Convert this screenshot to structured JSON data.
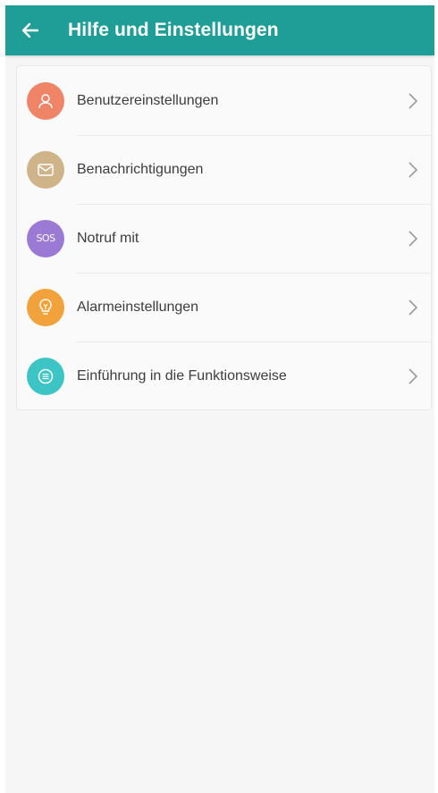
{
  "app_bar": {
    "title": "Hilfe und Einstellungen",
    "color": "#1f9e98"
  },
  "menu": {
    "items": [
      {
        "label": "Benutzereinstellungen",
        "icon": "user-icon",
        "color": "#ef8467"
      },
      {
        "label": "Benachrichtigungen",
        "icon": "mail-icon",
        "color": "#cfb48a"
      },
      {
        "label": "Notruf mit",
        "icon": "sos-icon",
        "icon_text": "SOS",
        "color": "#9b7ad6"
      },
      {
        "label": "Alarmeinstellungen",
        "icon": "bulb-icon",
        "color": "#f2a23a"
      },
      {
        "label": "Einführung in die Funktionsweise",
        "icon": "list-icon",
        "color": "#3dc5c6"
      }
    ]
  }
}
